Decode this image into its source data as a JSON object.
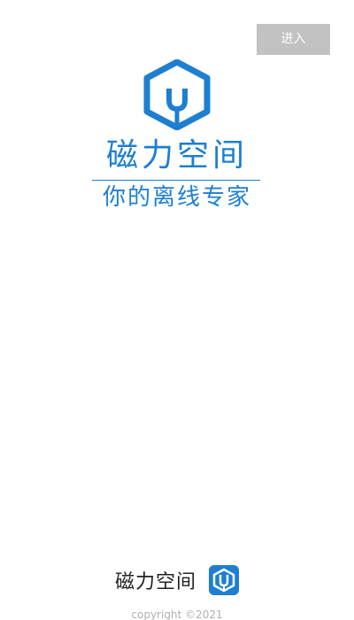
{
  "header": {
    "enter_button_label": "进入"
  },
  "brand": {
    "logo_icon": "magnet-hexagon-icon",
    "app_name": "磁力空间",
    "slogan": "你的离线专家"
  },
  "footer": {
    "app_name": "磁力空间",
    "app_icon": "magnet-app-icon",
    "copyright": "copyright ©2021"
  },
  "colors": {
    "brand_blue": "#1e7fd0",
    "button_gray": "#c2c2c2",
    "copyright_gray": "#b0b0b0"
  }
}
